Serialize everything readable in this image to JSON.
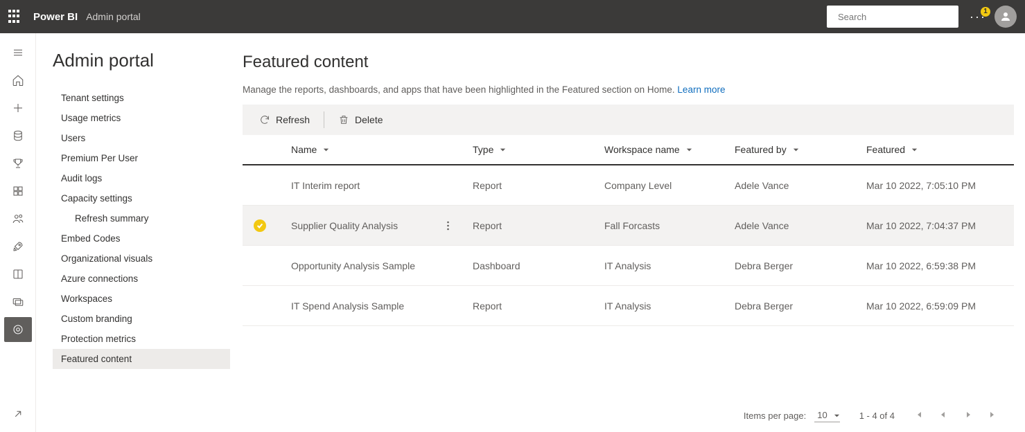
{
  "header": {
    "brand": "Power BI",
    "subtitle": "Admin portal",
    "search_placeholder": "Search",
    "notification_count": "1"
  },
  "page_title": "Admin portal",
  "nav_items": [
    {
      "label": "Tenant settings",
      "selected": false
    },
    {
      "label": "Usage metrics",
      "selected": false
    },
    {
      "label": "Users",
      "selected": false
    },
    {
      "label": "Premium Per User",
      "selected": false
    },
    {
      "label": "Audit logs",
      "selected": false
    },
    {
      "label": "Capacity settings",
      "selected": false
    },
    {
      "label": "Refresh summary",
      "selected": false,
      "sub": true
    },
    {
      "label": "Embed Codes",
      "selected": false
    },
    {
      "label": "Organizational visuals",
      "selected": false
    },
    {
      "label": "Azure connections",
      "selected": false
    },
    {
      "label": "Workspaces",
      "selected": false
    },
    {
      "label": "Custom branding",
      "selected": false
    },
    {
      "label": "Protection metrics",
      "selected": false
    },
    {
      "label": "Featured content",
      "selected": true
    }
  ],
  "content": {
    "title": "Featured content",
    "description": "Manage the reports, dashboards, and apps that have been highlighted in the Featured section on Home. ",
    "learn_more": "Learn more",
    "toolbar": {
      "refresh": "Refresh",
      "delete": "Delete"
    },
    "columns": {
      "name": "Name",
      "type": "Type",
      "workspace": "Workspace name",
      "featured_by": "Featured by",
      "featured": "Featured"
    },
    "rows": [
      {
        "selected": false,
        "name": "IT Interim report",
        "type": "Report",
        "workspace": "Company Level",
        "featured_by": "Adele Vance",
        "featured": "Mar 10 2022, 7:05:10 PM"
      },
      {
        "selected": true,
        "name": "Supplier Quality Analysis",
        "type": "Report",
        "workspace": "Fall Forcasts",
        "featured_by": "Adele Vance",
        "featured": "Mar 10 2022, 7:04:37 PM"
      },
      {
        "selected": false,
        "name": "Opportunity Analysis Sample",
        "type": "Dashboard",
        "workspace": "IT Analysis",
        "featured_by": "Debra Berger",
        "featured": "Mar 10 2022, 6:59:38 PM"
      },
      {
        "selected": false,
        "name": "IT Spend Analysis Sample",
        "type": "Report",
        "workspace": "IT Analysis",
        "featured_by": "Debra Berger",
        "featured": "Mar 10 2022, 6:59:09 PM"
      }
    ],
    "pagination": {
      "items_per_page_label": "Items per page:",
      "items_per_page_value": "10",
      "range": "1 - 4 of 4"
    }
  }
}
